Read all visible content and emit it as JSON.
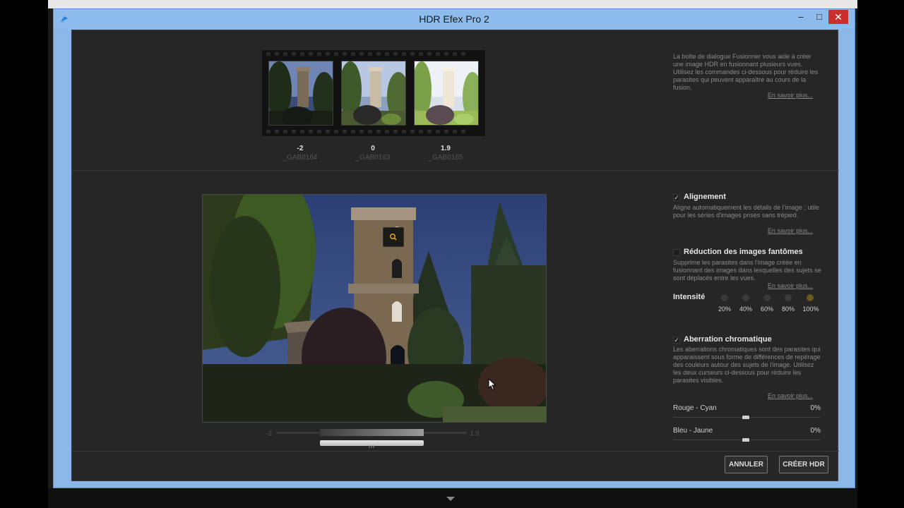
{
  "window": {
    "title": "HDR Efex Pro 2",
    "controls": {
      "minimize": "–",
      "maximize": "□",
      "close": "✕"
    }
  },
  "merge": {
    "thumbnails": [
      {
        "ev": "-2",
        "file": "_GAB0164"
      },
      {
        "ev": "0",
        "file": "_GAB0163"
      },
      {
        "ev": "1.9",
        "file": "_GAB0165"
      }
    ],
    "intro_text": "La boîte de dialogue Fusionner vous aide à créer une image HDR en fusionnant plusieurs vues. Utilisez les commandes ci-dessous pour réduire les parasites qui peuvent apparaître au cours de la fusion.",
    "intro_link": "En savoir plus..."
  },
  "preview": {
    "ev_min_label": "-2",
    "ev_max_label": "1.9"
  },
  "options": {
    "alignment": {
      "checked": true,
      "check_glyph": "✓",
      "title": "Alignement",
      "desc": "Aligne automatiquement les détails de l'image ; utile pour les séries d'images prises sans trépied.",
      "link": "En savoir plus..."
    },
    "ghost": {
      "checked": false,
      "check_glyph": "",
      "title": "Réduction des images fantômes",
      "desc": "Supprime les parasites dans l'image créée en fusionnant des images dans lesquelles des sujets se sont déplacés entre les vues.",
      "link": "En savoir plus...",
      "intensity_label": "Intensité",
      "intensity_options": [
        "20%",
        "40%",
        "60%",
        "80%",
        "100%"
      ],
      "intensity_selected": "100%"
    },
    "chromatic": {
      "checked": true,
      "check_glyph": "✓",
      "title": "Aberration chromatique",
      "desc": "Les aberrations chromatiques sont des parasites qui apparaissent sous forme de différences de repérage des couleurs autour des sujets de l'image. Utilisez les deux curseurs ci-dessous pour réduire les parasites visibles.",
      "link": "En savoir plus...",
      "sliders": [
        {
          "label": "Rouge - Cyan",
          "value": "0%"
        },
        {
          "label": "Bleu - Jaune",
          "value": "0%"
        }
      ]
    }
  },
  "footer": {
    "cancel_label": "ANNULER",
    "create_label": "CRÉER HDR"
  },
  "colors": {
    "panel": "#262626",
    "title_bar": "#8cbbec",
    "close": "#c9302c"
  }
}
